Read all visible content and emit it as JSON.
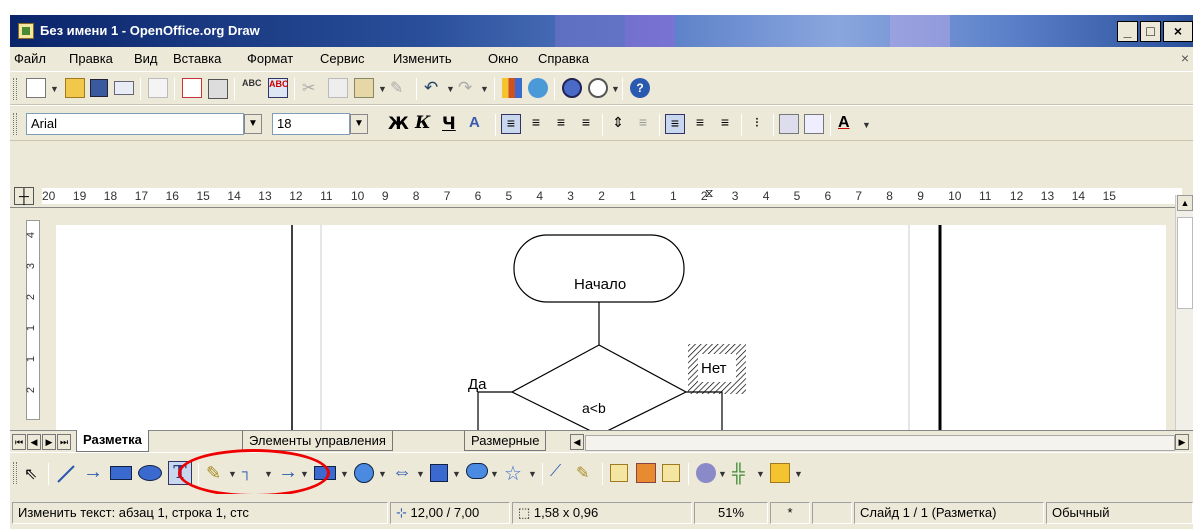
{
  "window": {
    "title": "Без имени 1 - OpenOffice.org Draw",
    "minimize": "_",
    "restore": "□",
    "close": "×"
  },
  "menu": {
    "items": [
      "Файл",
      "Правка",
      "Вид",
      "Вставка",
      "Формат",
      "Сервис",
      "Изменить",
      "Окно",
      "Справка"
    ],
    "close": "×"
  },
  "font_toolbar": {
    "font_name": "Arial",
    "font_size": "18",
    "bold": "Ж",
    "italic": "К",
    "underline": "Ч"
  },
  "ruler": {
    "box": "┼",
    "numbers": [
      "20",
      "19",
      "18",
      "17",
      "16",
      "15",
      "14",
      "13",
      "12",
      "11",
      "10",
      "9",
      "8",
      "7",
      "6",
      "5",
      "4",
      "3",
      "2",
      "1",
      "1",
      "2",
      "3",
      "4",
      "5",
      "6",
      "7",
      "8",
      "9",
      "10",
      "11",
      "12",
      "13",
      "14",
      "15"
    ],
    "vertical": [
      "4",
      "3",
      "2",
      "1",
      "1",
      "2"
    ]
  },
  "flowchart": {
    "start": "Начало",
    "condition": "a<b",
    "yes": "Да",
    "no": "Нет"
  },
  "tabs": {
    "items": [
      "Разметка",
      "Элементы управления",
      "Размерные"
    ]
  },
  "status": {
    "text": "Изменить текст: абзац 1, строка 1, стс",
    "position": "12,00 / 7,00",
    "size": "1,58 x 0,96",
    "zoom": "51%",
    "modified": "*",
    "slide": "Слайд 1 / 1 (Разметка)",
    "mode": "Обычный"
  },
  "colors": {
    "title_bg": "#0a246a",
    "highlight": "#e00000",
    "toolbar_bg": "#ece9d8"
  }
}
